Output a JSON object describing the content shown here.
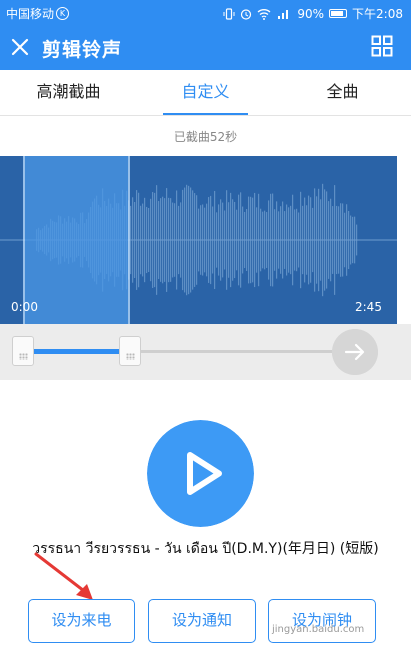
{
  "status_bar": {
    "carrier": "中国移动",
    "carrier_badge": "K",
    "battery_text": "90%",
    "time": "下午2:08"
  },
  "app_bar": {
    "title": "剪辑铃声",
    "close_icon": "close-icon",
    "grid_icon": "grid-icon"
  },
  "tabs": [
    {
      "label": "高潮截曲",
      "active": false
    },
    {
      "label": "自定义",
      "active": true
    },
    {
      "label": "全曲",
      "active": false
    }
  ],
  "clip_info": "已截曲52秒",
  "waveform": {
    "start_time": "0:00",
    "end_time": "2:45"
  },
  "song": {
    "title": "วรรธนา วีรยวรรธน - วัน เดือน ปี(D.M.Y)(年月日) (短版)"
  },
  "actions": {
    "set_ringtone": "设为来电",
    "set_notification": "设为通知",
    "set_alarm": "设为闹钟"
  },
  "watermark": "jingyan.baidu.com",
  "colors": {
    "primary": "#2f8df2",
    "waveform_bg": "#2a63a7",
    "selection": "#4a97e6",
    "play_button": "#3d9af5"
  }
}
